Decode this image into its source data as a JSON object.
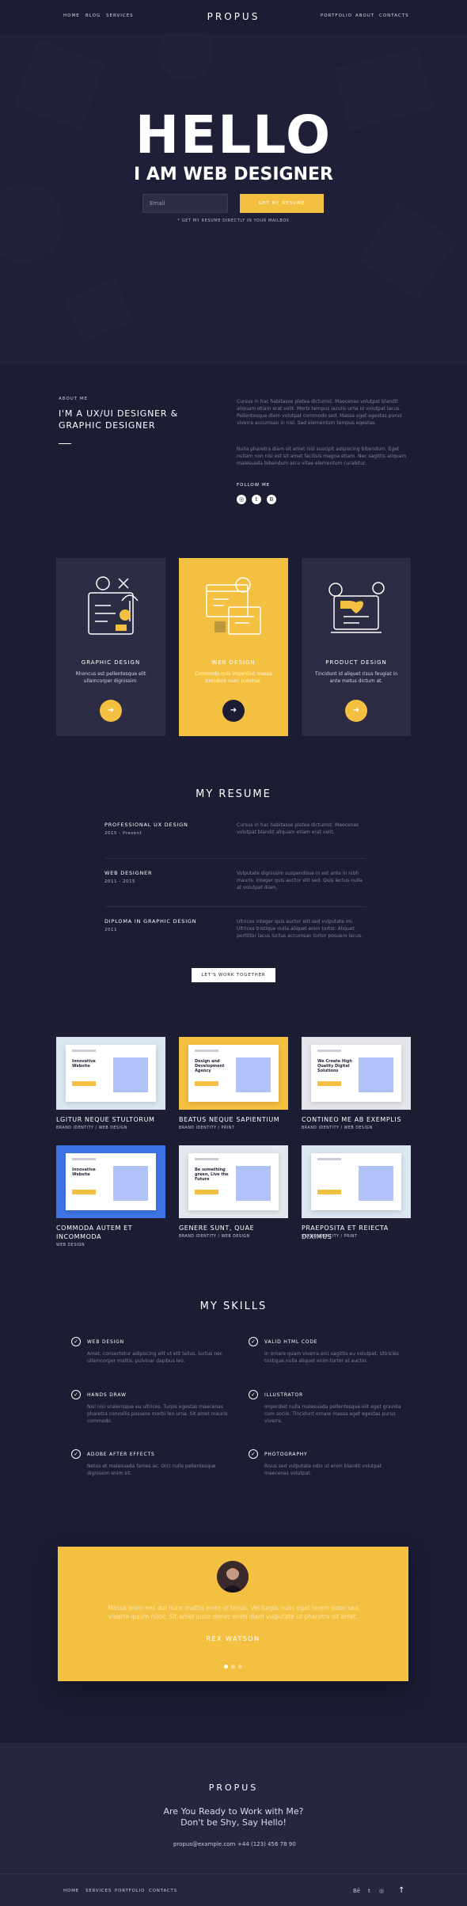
{
  "nav": {
    "left": [
      "HOME",
      "BLOG",
      "SERVICES"
    ],
    "logo": "PROPUS",
    "right": [
      "PORTFOLIO",
      "ABOUT",
      "CONTACTS"
    ]
  },
  "hero": {
    "title": "HELLO",
    "subtitle": "I AM WEB DESIGNER",
    "email_placeholder": "Email",
    "button": "GET MY RESUME",
    "note": "* GET MY RESUME DIRECTLY IN YOUR MAILBOX"
  },
  "about": {
    "label": "ABOUT ME",
    "heading": "I'M A UX/UI DESIGNER & GRAPHIC DESIGNER",
    "p1": "Cursus in hac habitasse platea dictumst. Maecenas volutpat blandit aliquam etiam erat velit. Morbi tempus iaculis urna id volutpat lacus. Pellentesque diam volutpat commodo sed. Massa eget egestas purus viverra accumsan in nisl. Sed elementum tempus egestas.",
    "p2": "Nulla pharetra diam sit amet nisl suscipit adipiscing bibendum. Eget nullam non nisi est sit amet facilisis magna etiam. Nec sagittis aliquam malesuada bibendum arcu vitae elementum curabitur.",
    "follow": "FOLLOW ME",
    "social_icons": [
      "dribbble-icon",
      "twitter-icon",
      "behance-icon"
    ]
  },
  "services": [
    {
      "title": "GRAPHIC DESIGN",
      "desc": "Rhoncus est pellentesque elit ullamcorper dignissim.",
      "active": false
    },
    {
      "title": "WEB DESIGN",
      "desc": "Commodo quis imperdiet massa tincidunt nunc pulvinar.",
      "active": true
    },
    {
      "title": "PRODUCT DESIGN",
      "desc": "Tincidunt id aliquet risus feugiat in ante metus dictum at.",
      "active": false
    }
  ],
  "resume": {
    "title": "MY RESUME",
    "items": [
      {
        "title": "PROFESSIONAL UX DESIGN",
        "date": "2015 - Present",
        "desc": "Cursus in hac habitasse platea dictumst. Maecenas volutpat blandit aliquam etiam erat velit."
      },
      {
        "title": "WEB DESIGNER",
        "date": "2011 - 2015",
        "desc": "Vulputate dignissim suspendisse in est ante in nibh mauris. Integer quis auctor elit sed. Quis lectus nulla at volutpat diam."
      },
      {
        "title": "DIPLOMA IN GRAPHIC DESIGN",
        "date": "2011",
        "desc": "Ultrices integer quis auctor elit sed vulputate mi. Ultrices tristique nulla aliquet enim tortor. Aliquet porttitor lacus luctus accumsan tortor posuere lacus."
      }
    ],
    "cta": "LET'S WORK TOGETHER"
  },
  "portfolio": [
    {
      "title": "LGITUR NEQUE STULTORUM",
      "cat": "BRAND IDENTITY / WEB DESIGN",
      "headline": "Innovative Website",
      "bg": "#dbe6f2"
    },
    {
      "title": "BEATUS NEQUE SAPIENTIUM",
      "cat": "BRAND IDENTITY / PRINT",
      "headline": "Design and Development Agency",
      "bg": "#f4c041"
    },
    {
      "title": "CONTINEO ME AB EXEMPLIS",
      "cat": "BRAND IDENTITY / WEB DESIGN",
      "headline": "We Create High Quality Digital Solutions",
      "bg": "#e4e6ec"
    },
    {
      "title": "COMMODA AUTEM ET INCOMMODA",
      "cat": "WEB DESIGN",
      "headline": "Innovative Website",
      "bg": "#3e74e6"
    },
    {
      "title": "GENERE SUNT, QUAE",
      "cat": "BRAND IDENTITY / WEB DESIGN",
      "headline": "Be something green, Live the Future",
      "bg": "#e4e8ee"
    },
    {
      "title": "PRAEPOSITA ET REIECTA DIXIMUS",
      "cat": "BRAND IDENTITY / PRINT",
      "headline": "",
      "bg": "#dbe6f2"
    }
  ],
  "skills": {
    "title": "MY SKILLS",
    "items": [
      {
        "title": "WEB DESIGN",
        "desc": "Amet, consectetur adipiscing elit ut elit tellus, luctus nec ullamcorper mattis, pulvinar dapibus leo."
      },
      {
        "title": "VALID HTML CODE",
        "desc": "In ornare quam viverra orci sagittis eu volutpat. Ultricies tristique nulla aliquet enim tortor at auctor."
      },
      {
        "title": "HANDS DRAW",
        "desc": "Nisl nisi scelerisque eu ultrices. Turpis egestas maecenas pharetra convallis posuere morbi leo urna. Sit amet mauris commodo."
      },
      {
        "title": "ILLUSTRATOR",
        "desc": "Imperdiet nulla malesuada pellentesque elit eget gravida cum sociis. Tincidunt ornare massa eget egestas purus viverra."
      },
      {
        "title": "ADOBE AFTER EFFECTS",
        "desc": "Netus et malesuada fames ac. Orci nulla pellentesque dignissim enim sit."
      },
      {
        "title": "PHOTOGRAPHY",
        "desc": "Risus sed vulputate odio ut enim blandit volutpat maecenas volutpat."
      }
    ]
  },
  "testimonial": {
    "quote": "Massa enim nec dui nunc mattis enim ut tellus. Vel turpis nunc eget lorem dolor sed viverra ipsum nunc. Sit amet justo donec enim diam vulputate ut pharetra sit amet.",
    "name": "REX WATSON"
  },
  "footer": {
    "logo": "PROPUS",
    "line1": "Are You Ready to Work with Me?",
    "line2": "Don't be Shy, Say Hello!",
    "email": "propus@example.com",
    "phone": "+44 (123) 456 78 90",
    "nav": [
      "HOME",
      "SERVICES",
      "PORTFOLIO",
      "CONTACTS"
    ],
    "social_icons": [
      "behance-icon",
      "twitter-icon",
      "dribbble-icon"
    ]
  },
  "colors": {
    "accent": "#f4c041",
    "background": "#1c1c33",
    "card": "#2c2c44"
  }
}
